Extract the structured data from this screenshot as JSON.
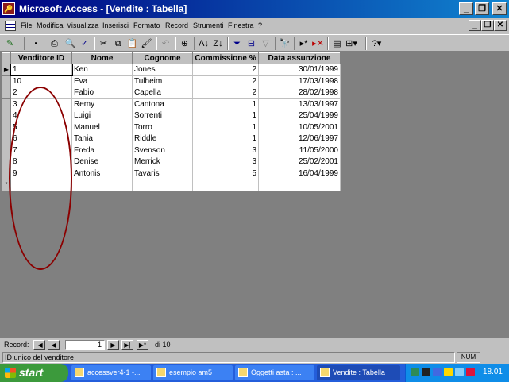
{
  "window": {
    "title": "Microsoft Access - [Vendite : Tabella]",
    "app_icon": "access-icon"
  },
  "menu": [
    "File",
    "Modifica",
    "Visualizza",
    "Inserisci",
    "Formato",
    "Record",
    "Strumenti",
    "Finestra",
    "?"
  ],
  "table": {
    "columns": [
      "Venditore ID",
      "Nome",
      "Cognome",
      "Commissione %",
      "Data assunzione"
    ],
    "rows": [
      [
        "1",
        "Ken",
        "Jones",
        "2",
        "30/01/1999"
      ],
      [
        "10",
        "Eva",
        "Tulheim",
        "2",
        "17/03/1998"
      ],
      [
        "2",
        "Fabio",
        "Capella",
        "2",
        "28/02/1998"
      ],
      [
        "3",
        "Remy",
        "Cantona",
        "1",
        "13/03/1997"
      ],
      [
        "4",
        "Luigi",
        "Sorrenti",
        "1",
        "25/04/1999"
      ],
      [
        "5",
        "Manuel",
        "Torro",
        "1",
        "10/05/2001"
      ],
      [
        "6",
        "Tania",
        "Riddle",
        "1",
        "12/06/1997"
      ],
      [
        "7",
        "Freda",
        "Svenson",
        "3",
        "11/05/2000"
      ],
      [
        "8",
        "Denise",
        "Merrick",
        "3",
        "25/02/2001"
      ],
      [
        "9",
        "Antonis",
        "Tavaris",
        "5",
        "16/04/1999"
      ]
    ],
    "new_row_marker": "*"
  },
  "navigation": {
    "label": "Record:",
    "current": "1",
    "total": "di 10"
  },
  "status": {
    "text": "ID unico del venditore",
    "num": "NUM"
  },
  "taskbar": {
    "start": "start",
    "tasks": [
      "accessver4-1 -...",
      "esempio am5",
      "Oggetti asta : ...",
      "Vendite : Tabella"
    ],
    "clock": "18.01"
  },
  "colors": {
    "title_bar": "#000080",
    "annotation_oval": "#8b0000",
    "taskbar": "#245edb"
  }
}
